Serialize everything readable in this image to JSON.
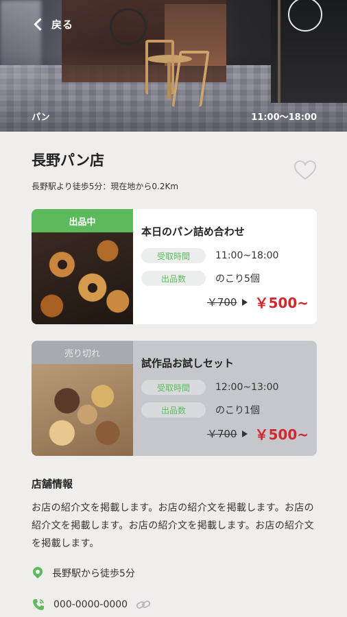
{
  "header": {
    "back_label": "戻る",
    "category": "パン",
    "hours": "11:00〜18:00"
  },
  "store": {
    "name": "長野パン店",
    "access": "長野駅より徒歩5分：現在地から0.2Km"
  },
  "offers": [
    {
      "status": "出品中",
      "title": "本日のパン詰め合わせ",
      "pickup_label": "受取時間",
      "pickup_value": "11:00~18:00",
      "stock_label": "出品数",
      "stock_value": "のこり5個",
      "old_price": "￥700",
      "new_price": "￥500~"
    },
    {
      "status": "売り切れ",
      "title": "試作品お試しセット",
      "pickup_label": "受取時間",
      "pickup_value": "12:00~13:00",
      "stock_label": "出品数",
      "stock_value": "のこり1個",
      "old_price": "￥700",
      "new_price": "￥500~"
    }
  ],
  "info": {
    "section_title": "店舗情報",
    "intro": "お店の紹介文を掲載します。お店の紹介文を掲載します。お店の紹介文を掲載します。お店の紹介文を掲載します。お店の紹介文を掲載します。",
    "access": "長野駅から徒歩5分",
    "phone": "000-0000-0000"
  },
  "colors": {
    "accent_green": "#5cba5d",
    "price_red": "#d3262e",
    "background": "#f0eeec"
  }
}
